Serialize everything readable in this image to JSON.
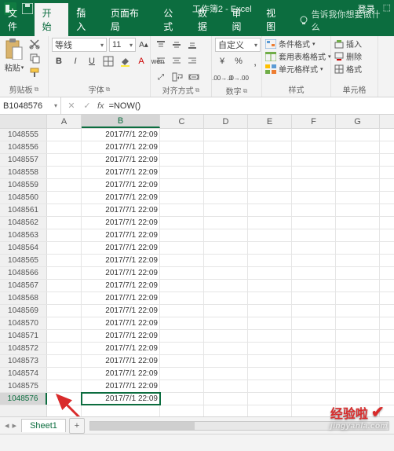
{
  "title": "工作簿2 - Excel",
  "login": "登录",
  "tabs": {
    "file": "文件",
    "home": "开始",
    "insert": "插入",
    "pagelayout": "页面布局",
    "formulas": "公式",
    "data": "数据",
    "review": "审阅",
    "view": "视图",
    "tellme": "告诉我你想要做什么"
  },
  "ribbon": {
    "clipboard": {
      "paste": "粘贴",
      "label": "剪贴板"
    },
    "font": {
      "name": "等线",
      "size": "11",
      "b": "B",
      "i": "I",
      "u": "U",
      "wen": "wén",
      "label": "字体"
    },
    "align": {
      "label": "对齐方式"
    },
    "number": {
      "format": "自定义",
      "label": "数字"
    },
    "styles": {
      "cond": "条件格式",
      "table": "套用表格格式",
      "cell": "单元格样式",
      "label": "样式"
    },
    "cells": {
      "insert": "插入",
      "delete": "删除",
      "format": "格式",
      "label": "单元格"
    }
  },
  "namebox": "B1048576",
  "formula": "=NOW()",
  "columns": [
    "A",
    "B",
    "C",
    "D",
    "E",
    "F",
    "G"
  ],
  "rows": [
    {
      "n": "1048555",
      "v": "2017/7/1 22:09"
    },
    {
      "n": "1048556",
      "v": "2017/7/1 22:09"
    },
    {
      "n": "1048557",
      "v": "2017/7/1 22:09"
    },
    {
      "n": "1048558",
      "v": "2017/7/1 22:09"
    },
    {
      "n": "1048559",
      "v": "2017/7/1 22:09"
    },
    {
      "n": "1048560",
      "v": "2017/7/1 22:09"
    },
    {
      "n": "1048561",
      "v": "2017/7/1 22:09"
    },
    {
      "n": "1048562",
      "v": "2017/7/1 22:09"
    },
    {
      "n": "1048563",
      "v": "2017/7/1 22:09"
    },
    {
      "n": "1048564",
      "v": "2017/7/1 22:09"
    },
    {
      "n": "1048565",
      "v": "2017/7/1 22:09"
    },
    {
      "n": "1048566",
      "v": "2017/7/1 22:09"
    },
    {
      "n": "1048567",
      "v": "2017/7/1 22:09"
    },
    {
      "n": "1048568",
      "v": "2017/7/1 22:09"
    },
    {
      "n": "1048569",
      "v": "2017/7/1 22:09"
    },
    {
      "n": "1048570",
      "v": "2017/7/1 22:09"
    },
    {
      "n": "1048571",
      "v": "2017/7/1 22:09"
    },
    {
      "n": "1048572",
      "v": "2017/7/1 22:09"
    },
    {
      "n": "1048573",
      "v": "2017/7/1 22:09"
    },
    {
      "n": "1048574",
      "v": "2017/7/1 22:09"
    },
    {
      "n": "1048575",
      "v": "2017/7/1 22:09"
    },
    {
      "n": "1048576",
      "v": "2017/7/1 22:09"
    }
  ],
  "active_row": "1048576",
  "sheet": {
    "name": "Sheet1",
    "new": "+"
  },
  "watermark": {
    "brand": "经验啦",
    "url": "jingyanla.com"
  }
}
